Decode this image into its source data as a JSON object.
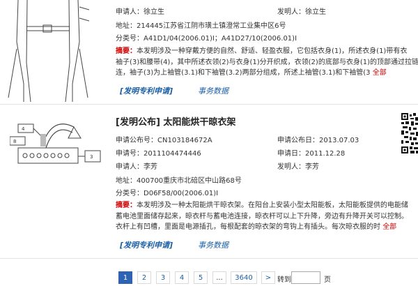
{
  "results": [
    {
      "applicant_label": "申请人：",
      "applicant": "徐立生",
      "inventor_label": "发明人：",
      "inventor": "徐立生",
      "address_label": "地址：",
      "address": "214445江苏省江阴市璜土镇澄常工业集中区6号",
      "class_label": "分类号：",
      "class": "A41D1/04(2006.01)I；A41D27/10(2006.01)I",
      "abstract_label": "摘要：",
      "abstract_lines": [
        "本发明涉及一种穿戴方便的自然、舒适、轻盈衣服，它包括衣身(1)，所述衣身(1)带有衣",
        "袖子(3)和腰带(4)，其中所述衣领(2)与衣身(1)分开织成，衣领(2)的底部与衣身(1)的顶部通过拉链",
        "连，袖子(3)为上袖管(3.1)和下袖管(3.2)两部分组成，所述上袖管(3.1)和下袖管(3"
      ],
      "more": "全部",
      "link_patent": "[发明专利申请]",
      "link_data": "事务数据"
    },
    {
      "title": "[发明公布] 太阳能烘干晾衣架",
      "pubno_label": "申请公布号：",
      "pubno": "CN103184672A",
      "pubdate_label": "申请公布日：",
      "pubdate": "2013.07.03",
      "appno_label": "申请号：",
      "appno": "2011104474446",
      "appdate_label": "申请日：",
      "appdate": "2011.12.28",
      "applicant_label": "申请人：",
      "applicant": "李芳",
      "inventor_label": "发明人：",
      "inventor": "李芳",
      "address_label": "地址：",
      "address": "400700重庆市北碚区中山路68号",
      "class_label": "分类号：",
      "class": "D06F58/00(2006.01)I",
      "abstract_label": "摘要：",
      "abstract_lines": [
        "本发明涉及一种太阳能烘干晾衣架。在阳台上安装小型太阳能板，太阳能板提供的电能储",
        "蓄电池里面储存起来，晾衣杆与蓄电池连接，晾衣杆可以上下升降，旁边有升降开关可以控制。",
        "衣杆上有凹槽，里面是电源插孔，每根配套的晾衣架的弯钩上有插头。每次晾衣服的时"
      ],
      "more": "全部",
      "link_patent": "[发明专利申请]",
      "link_data": "事务数据",
      "figure_labels": [
        "4",
        "8",
        "3"
      ]
    }
  ],
  "pagination": {
    "pages": [
      "1",
      "2",
      "3",
      "4",
      "5",
      "...",
      "3640"
    ],
    "next": ">",
    "goto_label": "转到",
    "page_suffix": "页",
    "goto_value": ""
  }
}
